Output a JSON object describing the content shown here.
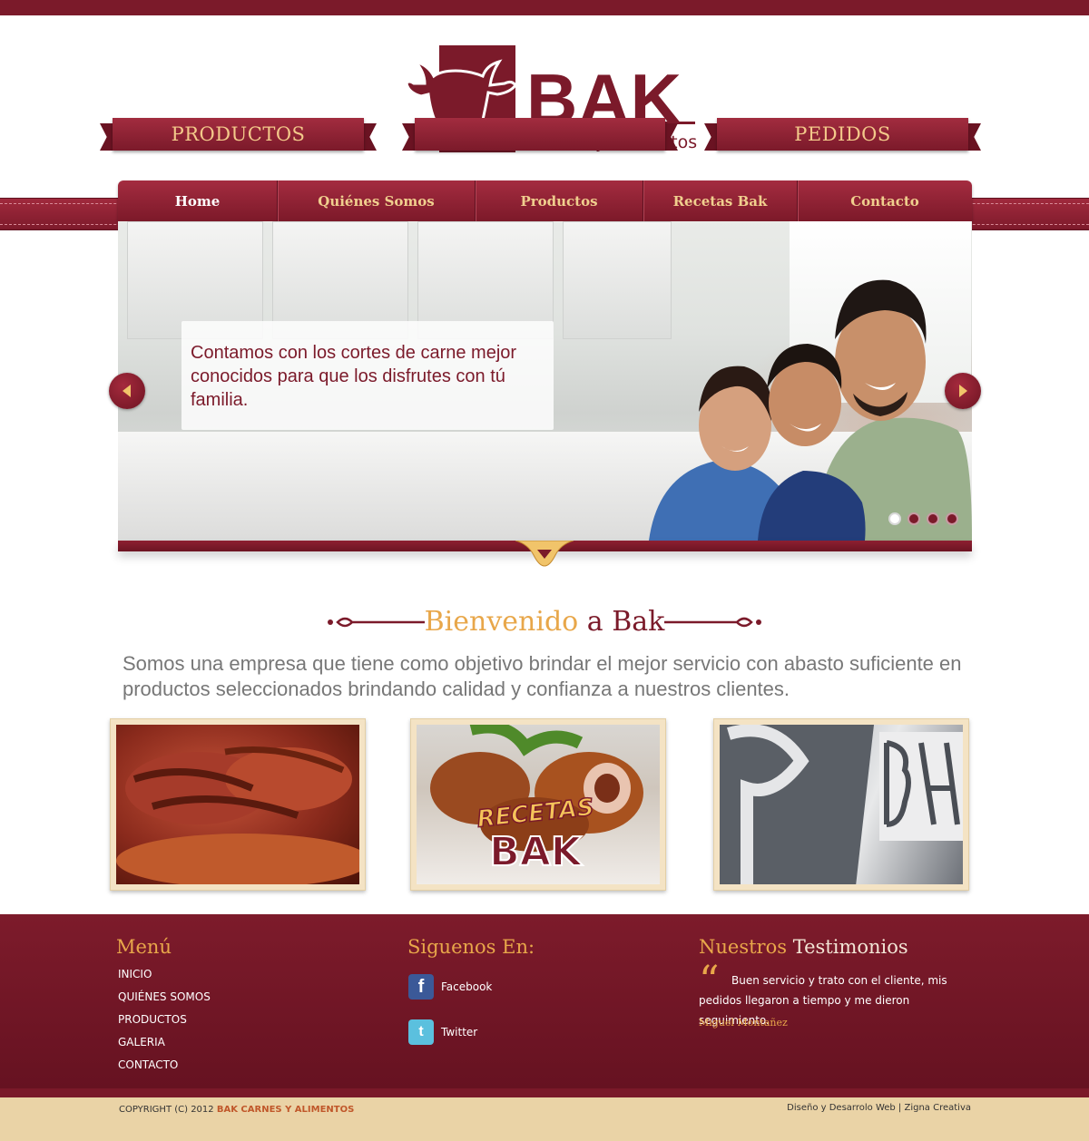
{
  "logo": {
    "wordmark": "BAK",
    "tagline": "Carnes y Alimentos"
  },
  "nav": [
    {
      "label": "Home"
    },
    {
      "label": "Quiénes Somos"
    },
    {
      "label": "Productos"
    },
    {
      "label": "Recetas Bak"
    },
    {
      "label": "Contacto"
    }
  ],
  "hero": {
    "caption": "Contamos con los cortes de carne mejor conocidos para que los disfrutes con tú familia.",
    "active_slide": 1,
    "slide_count": 4
  },
  "welcome": {
    "title_part1": "Bienvenido",
    "title_part2": "a Bak",
    "intro": "Somos una empresa que tiene como objetivo brindar el mejor servicio con abasto suficiente en productos seleccionados brindando calidad y confianza a nuestros clientes."
  },
  "cards": [
    {
      "label": "PRODUCTOS"
    },
    {
      "label": "",
      "badge_line1": "RECETAS",
      "badge_line2": "BAK"
    },
    {
      "label": "PEDIDOS"
    }
  ],
  "footer": {
    "menu_title": "Menú",
    "menu": [
      "INICIO",
      "QUIÉNES SOMOS",
      "PRODUCTOS",
      "GALERIA",
      "CONTACTO"
    ],
    "social_title_part1": "Siguenos",
    "social_title_part2": "En:",
    "social": [
      {
        "label": "Facebook",
        "icon": "facebook-icon"
      },
      {
        "label": "Twitter",
        "icon": "twitter-icon"
      }
    ],
    "testimonials_title_part1": "Nuestros",
    "testimonials_title_part2": "Testimonios",
    "testimonial_text": "Buen servicio y trato con el cliente, mis pedidos llegaron a tiempo y me dieron seguimiento.",
    "testimonial_author": "Miguel Montañez",
    "copyright_prefix": "COPYRIGHT (C) 2012",
    "copyright_brand": "BAK CARNES Y ALIMENTOS",
    "credits": "Diseño y Desarrolo Web | Zigna Creativa"
  },
  "colors": {
    "brand": "#7b1a2a",
    "accent": "#e8a74a",
    "cream": "#ead3a6"
  }
}
